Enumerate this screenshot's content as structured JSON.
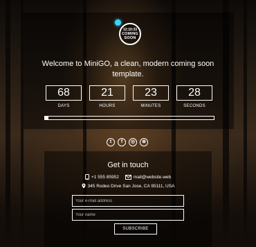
{
  "logo": {
    "time": "12:10:33",
    "line1": "COMING",
    "line2": "SOON"
  },
  "headline": "Welcome to MiniGO, a clean, modern coming soon template.",
  "countdown": [
    {
      "value": "68",
      "label": "DAYS"
    },
    {
      "value": "21",
      "label": "HOURS"
    },
    {
      "value": "23",
      "label": "MINUTES"
    },
    {
      "value": "28",
      "label": "SECONDS"
    }
  ],
  "progress": {
    "percent": 2
  },
  "socials": [
    {
      "icon": "twitter-icon",
      "glyph": "t"
    },
    {
      "icon": "facebook-icon",
      "glyph": "f"
    },
    {
      "icon": "instagram-icon",
      "glyph": "◎"
    },
    {
      "icon": "dribbble-icon",
      "glyph": "⊛"
    }
  ],
  "contact": {
    "title": "Get in touch",
    "phone": "+1 555 85952",
    "email": "mail@website.web",
    "address": "345 Rodeo Drive San Jose, CA 95111, USA"
  },
  "form": {
    "email_placeholder": "Your e-mail address",
    "name_placeholder": "Your name",
    "subscribe_label": "SUBSCRIBE"
  },
  "colors": {
    "accent": "#38d4ff",
    "text": "#ffffff"
  }
}
